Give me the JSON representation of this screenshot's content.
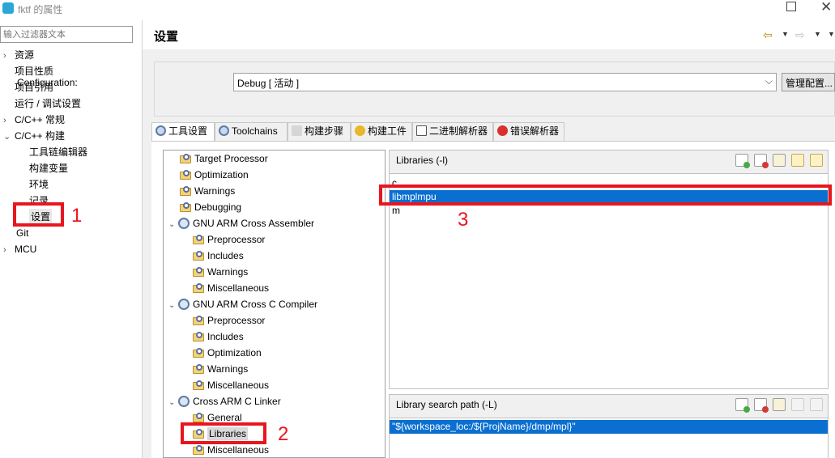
{
  "window": {
    "title": "fktf 的属性"
  },
  "filter": {
    "placeholder": "输入过滤器文本"
  },
  "left_tree": [
    {
      "label": "资源",
      "arrow": "›"
    },
    {
      "label": "项目性质",
      "arrow": ""
    },
    {
      "label": "项目引用",
      "arrow": ""
    },
    {
      "label": "运行 / 调试设置",
      "arrow": ""
    },
    {
      "label": "C/C++ 常规",
      "arrow": "›"
    },
    {
      "label": "C/C++ 构建",
      "arrow": "⌄"
    },
    {
      "label": "工具链编辑器",
      "arrow": ""
    },
    {
      "label": "构建变量",
      "arrow": ""
    },
    {
      "label": "环境",
      "arrow": ""
    },
    {
      "label": "记录",
      "arrow": ""
    },
    {
      "label": "设置",
      "arrow": ""
    },
    {
      "label": "Git",
      "arrow": ""
    },
    {
      "label": "MCU",
      "arrow": "›"
    }
  ],
  "page": {
    "title": "设置"
  },
  "config": {
    "label": "Configuration:",
    "value": "Debug  [ 活动 ]",
    "manage_label": "管理配置..."
  },
  "tabs": [
    {
      "label": "工具设置",
      "icon": "tool-settings-icon",
      "active": true
    },
    {
      "label": "Toolchains",
      "icon": "toolchains-icon"
    },
    {
      "label": "构建步骤",
      "icon": "build-steps-icon"
    },
    {
      "label": "构建工件",
      "icon": "build-artifact-icon"
    },
    {
      "label": "二进制解析器",
      "icon": "binary-parser-icon"
    },
    {
      "label": "错误解析器",
      "icon": "error-parser-icon"
    }
  ],
  "settings_tree": [
    {
      "label": "Target Processor"
    },
    {
      "label": "Optimization"
    },
    {
      "label": "Warnings"
    },
    {
      "label": "Debugging"
    },
    {
      "label": "GNU ARM Cross Assembler"
    },
    {
      "label": "Preprocessor"
    },
    {
      "label": "Includes"
    },
    {
      "label": "Warnings"
    },
    {
      "label": "Miscellaneous"
    },
    {
      "label": "GNU ARM Cross C Compiler"
    },
    {
      "label": "Preprocessor"
    },
    {
      "label": "Includes"
    },
    {
      "label": "Optimization"
    },
    {
      "label": "Warnings"
    },
    {
      "label": "Miscellaneous"
    },
    {
      "label": "Cross ARM C Linker"
    },
    {
      "label": "General"
    },
    {
      "label": "Libraries"
    },
    {
      "label": "Miscellaneous"
    }
  ],
  "libraries": {
    "title": "Libraries (-l)",
    "items": [
      "c",
      "libmplmpu",
      "m"
    ],
    "selected_index": 1
  },
  "library_paths": {
    "title": "Library search path (-L)",
    "items": [
      "\"${workspace_loc:/${ProjName}/dmp/mpl}\""
    ]
  },
  "annotations": [
    "1",
    "2",
    "3"
  ],
  "colors": {
    "selection": "#0a6fd1",
    "annotation": "#e8161f"
  }
}
